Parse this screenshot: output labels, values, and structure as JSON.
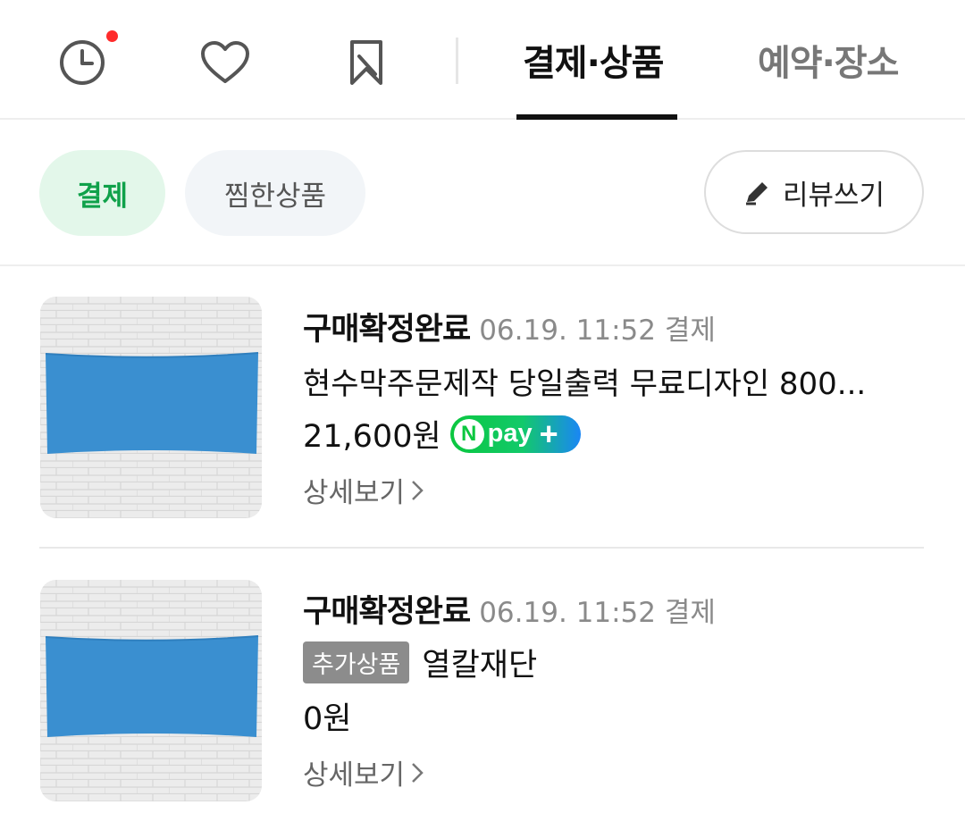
{
  "nav": {
    "tabs": [
      {
        "label": "결제·상품",
        "active": true
      },
      {
        "label": "예약·장소",
        "active": false
      }
    ],
    "icons": [
      "clock-icon",
      "heart-icon",
      "bookmark-icon"
    ],
    "notification_dot_color": "#ff2b2b"
  },
  "filters": {
    "chips": [
      {
        "label": "결제",
        "selected": true
      },
      {
        "label": "찜한상품",
        "selected": false
      }
    ],
    "review_button": "리뷰쓰기"
  },
  "orders": [
    {
      "status": "구매확정완료",
      "date": "06.19. 11:52 결제",
      "product_name": "현수막주문제작 당일출력 무료디자인 800...",
      "price": "21,600원",
      "npay": {
        "n": "N",
        "pay": "pay",
        "plus": "+"
      },
      "detail_link": "상세보기"
    },
    {
      "status": "구매확정완료",
      "date": "06.19. 11:52 결제",
      "addon_badge": "추가상품",
      "product_name": "열칼재단",
      "price": "0원",
      "detail_link": "상세보기"
    }
  ],
  "colors": {
    "accent_green": "#0fa14a",
    "chip_selected_bg": "#e3f7ea",
    "banner_blue": "#3a8fd0"
  }
}
